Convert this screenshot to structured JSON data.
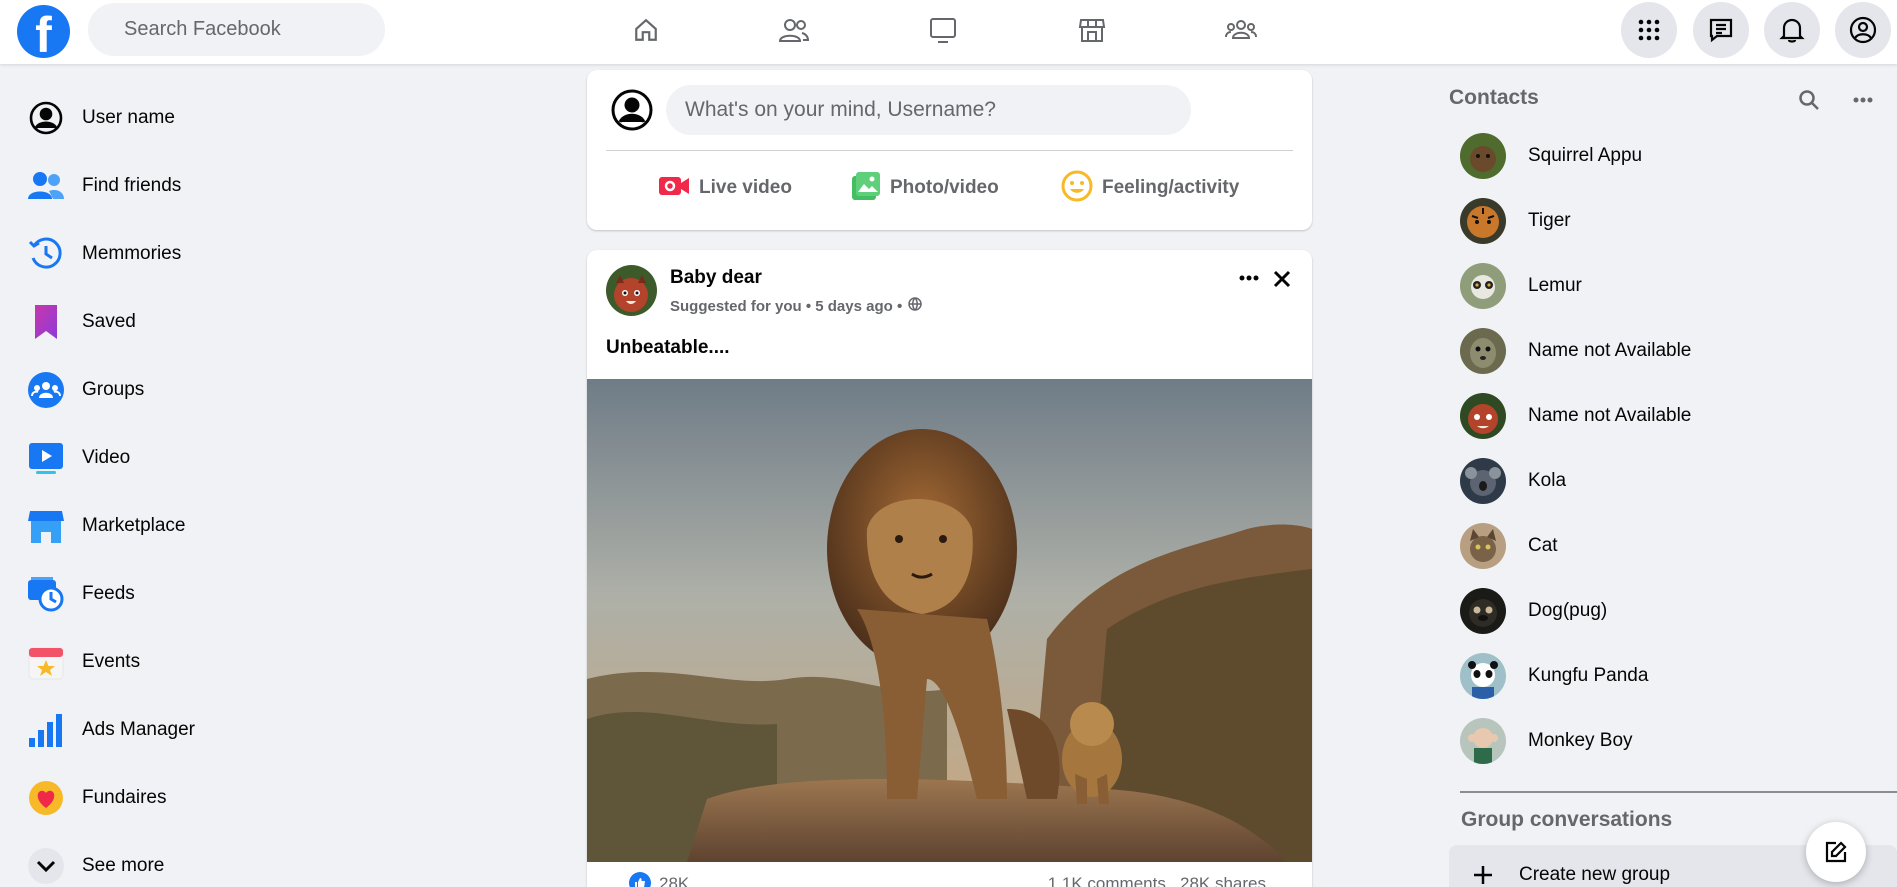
{
  "topbar": {
    "logo": "f",
    "search_placeholder": "Search Facebook"
  },
  "sidebar": {
    "items": [
      {
        "label": "User name",
        "icon": "profile-icon"
      },
      {
        "label": "Find friends",
        "icon": "friends-icon"
      },
      {
        "label": "Memmories",
        "icon": "memories-icon"
      },
      {
        "label": "Saved",
        "icon": "saved-icon"
      },
      {
        "label": "Groups",
        "icon": "groups-icon"
      },
      {
        "label": "Video",
        "icon": "video-icon"
      },
      {
        "label": "Marketplace",
        "icon": "marketplace-icon"
      },
      {
        "label": "Feeds",
        "icon": "feeds-icon"
      },
      {
        "label": "Events",
        "icon": "events-icon"
      },
      {
        "label": "Ads Manager",
        "icon": "ads-manager-icon"
      },
      {
        "label": "Fundaires",
        "icon": "fundraisers-icon"
      },
      {
        "label": "See more",
        "icon": "chevron-down-icon"
      }
    ]
  },
  "composer": {
    "placeholder": "What's on your mind, Username?",
    "actions": [
      {
        "label": "Live video",
        "icon": "live-video-icon",
        "color": "#f02849"
      },
      {
        "label": "Photo/video",
        "icon": "photo-video-icon",
        "color": "#45bd62"
      },
      {
        "label": "Feeling/activity",
        "icon": "feeling-icon",
        "color": "#f7b928"
      }
    ]
  },
  "post": {
    "author": "Baby dear",
    "meta": "Suggested for you • 5 days ago •",
    "text": "Unbeatable....",
    "stats_left": "28K",
    "stats_right": "1.1K comments   28K shares"
  },
  "contacts": {
    "title": "Contacts",
    "items": [
      {
        "name": "Squirrel Appu",
        "color": "#6b4a2b"
      },
      {
        "name": "Tiger",
        "color": "#c9772a"
      },
      {
        "name": "Lemur",
        "color": "#8f9d7a"
      },
      {
        "name": "Name not Available",
        "color": "#8d8c6e"
      },
      {
        "name": "Name not Available",
        "color": "#b3432a"
      },
      {
        "name": "Kola",
        "color": "#5b6470"
      },
      {
        "name": "Cat",
        "color": "#7a6248"
      },
      {
        "name": "Dog(pug)",
        "color": "#2f2b25"
      },
      {
        "name": "Kungfu Panda",
        "color": "#9fc0c8"
      },
      {
        "name": "Monkey Boy",
        "color": "#b7c5bd"
      }
    ]
  },
  "groups": {
    "title": "Group conversations",
    "create_label": "Create new group"
  },
  "colors": {
    "brand": "#1877f2",
    "background": "#f0f2f5",
    "secondary_text": "#65676b"
  }
}
